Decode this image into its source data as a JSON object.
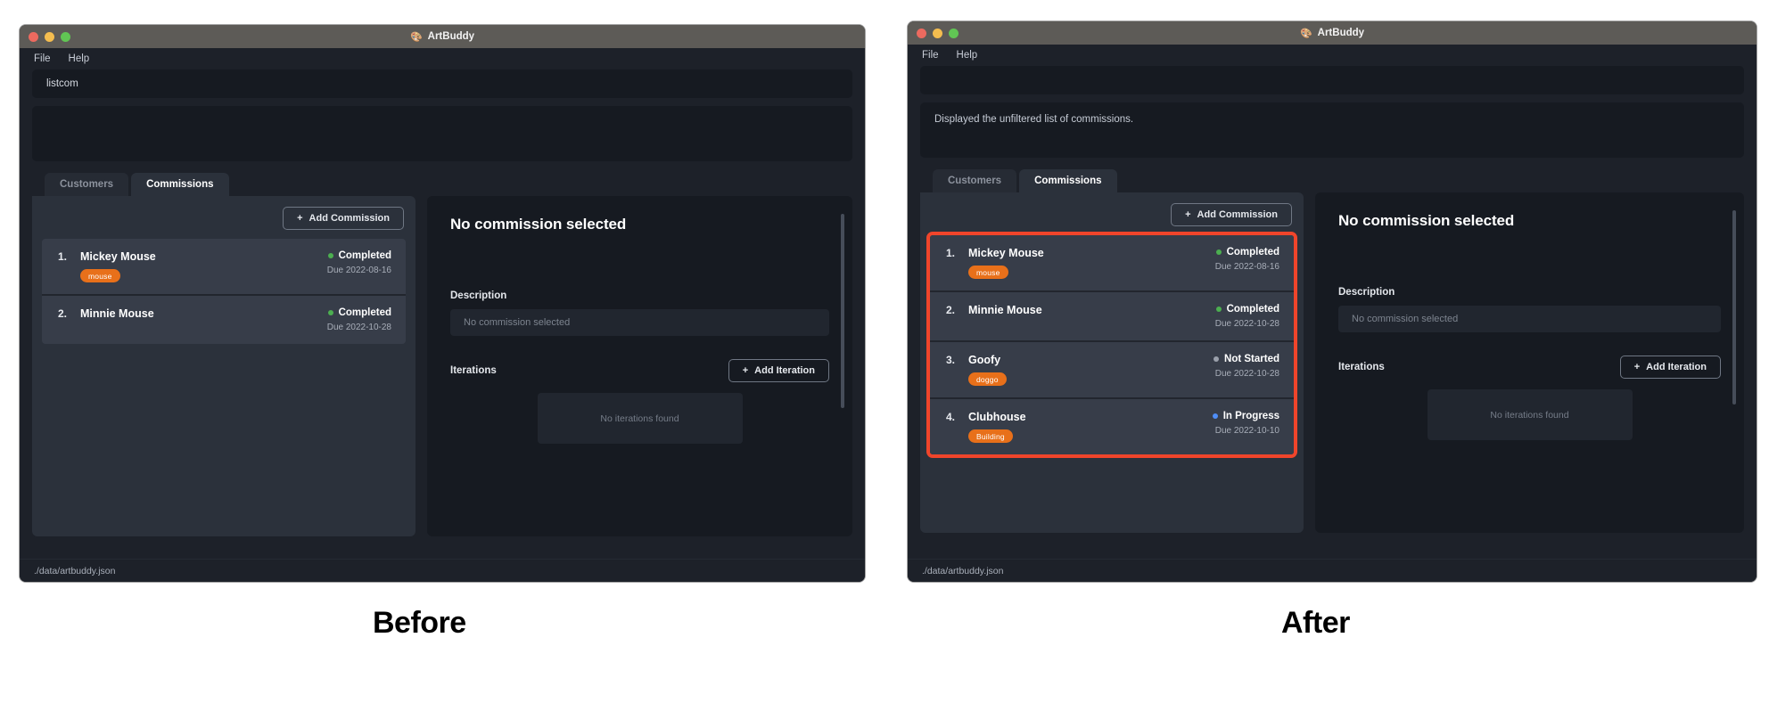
{
  "captions": {
    "before": "Before",
    "after": "After"
  },
  "window": {
    "title": "ArtBuddy",
    "title_icon": "palette-icon",
    "traffic_lights": [
      "close-button",
      "minimize-button",
      "zoom-button"
    ],
    "menu": [
      "File",
      "Help"
    ]
  },
  "before": {
    "command_input": {
      "value": "listcom",
      "placeholder": ""
    },
    "output_message": "",
    "tabs": [
      {
        "id": "customers",
        "label": "Customers",
        "active": false
      },
      {
        "id": "commissions",
        "label": "Commissions",
        "active": true
      }
    ],
    "add_commission_label": "Add Commission",
    "commissions": [
      {
        "index": "1.",
        "name": "Mickey Mouse",
        "tag": "mouse",
        "status": "Completed",
        "status_color": "#4caf50",
        "due": "Due 2022-08-16"
      },
      {
        "index": "2.",
        "name": "Minnie Mouse",
        "tag": "",
        "status": "Completed",
        "status_color": "#4caf50",
        "due": "Due 2022-10-28"
      }
    ],
    "detail": {
      "title": "No commission selected",
      "description_label": "Description",
      "description_value": "No commission selected",
      "iterations_label": "Iterations",
      "add_iteration_label": "Add Iteration",
      "iterations_empty": "No iterations found"
    },
    "statusbar": "./data/artbuddy.json"
  },
  "after": {
    "command_input": {
      "value": "",
      "placeholder": ""
    },
    "output_message": "Displayed the unfiltered list of commissions.",
    "tabs": [
      {
        "id": "customers",
        "label": "Customers",
        "active": false
      },
      {
        "id": "commissions",
        "label": "Commissions",
        "active": true
      }
    ],
    "add_commission_label": "Add Commission",
    "highlight_color": "#f0452b",
    "commissions": [
      {
        "index": "1.",
        "name": "Mickey Mouse",
        "tag": "mouse",
        "status": "Completed",
        "status_color": "#4caf50",
        "due": "Due 2022-08-16"
      },
      {
        "index": "2.",
        "name": "Minnie Mouse",
        "tag": "",
        "status": "Completed",
        "status_color": "#4caf50",
        "due": "Due 2022-10-28"
      },
      {
        "index": "3.",
        "name": "Goofy",
        "tag": "doggo",
        "status": "Not Started",
        "status_color": "#9aa0ab",
        "due": "Due 2022-10-28"
      },
      {
        "index": "4.",
        "name": "Clubhouse",
        "tag": "Building",
        "status": "In Progress",
        "status_color": "#4f8ef7",
        "due": "Due 2022-10-10"
      }
    ],
    "detail": {
      "title": "No commission selected",
      "description_label": "Description",
      "description_value": "No commission selected",
      "iterations_label": "Iterations",
      "add_iteration_label": "Add Iteration",
      "iterations_empty": "No iterations found"
    },
    "statusbar": "./data/artbuddy.json"
  }
}
